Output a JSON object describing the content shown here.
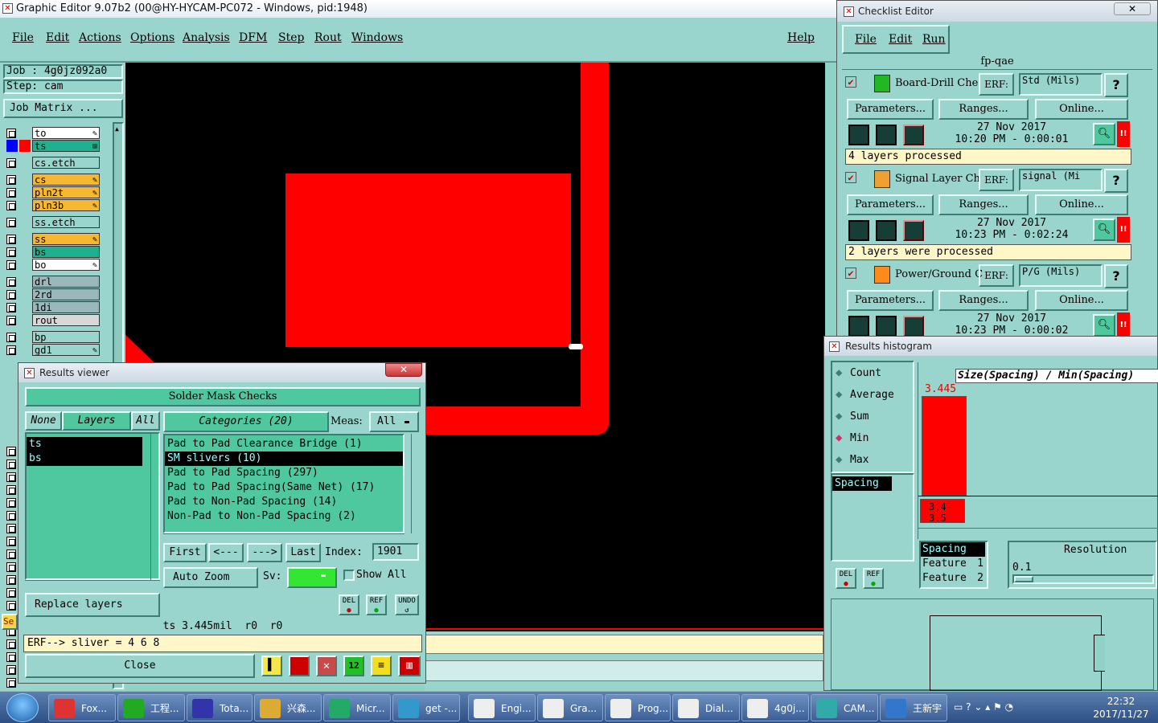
{
  "main_window": {
    "title": "Graphic Editor 9.07b2 (00@HY-HYCAM-PC072 - Windows, pid:1948)",
    "menu": [
      "File",
      "Edit",
      "Actions",
      "Options",
      "Analysis",
      "DFM",
      "Step",
      "Rout",
      "Windows"
    ],
    "help": "Help",
    "job_label": "Job : 4g0jz092a0",
    "step_label": "Step: cam",
    "job_matrix": "Job Matrix ...",
    "layers": [
      {
        "name": "to",
        "color": "#ffffff",
        "mark": "✎"
      },
      {
        "name": "ts",
        "color": "#20b090",
        "mark": "⊞"
      },
      {
        "name": "cs.etch",
        "color": "#99d5cc",
        "mark": ""
      },
      {
        "name": "cs",
        "color": "#f6b830",
        "mark": "✎"
      },
      {
        "name": "pln2t",
        "color": "#f6b830",
        "mark": "✎"
      },
      {
        "name": "pln3b",
        "color": "#f6b830",
        "mark": "✎"
      },
      {
        "name": "ss.etch",
        "color": "#99d5cc",
        "mark": ""
      },
      {
        "name": "ss",
        "color": "#f6b830",
        "mark": "✎"
      },
      {
        "name": "bs",
        "color": "#20b090",
        "mark": ""
      },
      {
        "name": "bo",
        "color": "#ffffff",
        "mark": "✎"
      },
      {
        "name": "drl",
        "color": "#9ab8bc",
        "mark": ""
      },
      {
        "name": "2rd",
        "color": "#9ab8bc",
        "mark": ""
      },
      {
        "name": "1di",
        "color": "#9ab8bc",
        "mark": ""
      },
      {
        "name": "rout",
        "color": "#d8d8d8",
        "mark": ""
      },
      {
        "name": "bp",
        "color": "#99d5cc",
        "mark": ""
      },
      {
        "name": "gd1",
        "color": "#99d5cc",
        "mark": "✎"
      }
    ],
    "se_label": "Se",
    "status_text": "ERF--> sliver = 4 6 8"
  },
  "results_viewer": {
    "title": "Results viewer",
    "header": "Solder Mask Checks",
    "none_btn": "None",
    "layers_btn": "Layers",
    "all_btn": "All",
    "layer_items": [
      "ts",
      "bs"
    ],
    "categories_btn": "Categories (20)",
    "meas_label": "Meas:",
    "meas_value": "All",
    "categories": [
      "Pad to Pad Clearance Bridge (1)",
      "SM slivers (10)",
      "Pad to Pad Spacing (297)",
      "Pad to Pad Spacing(Same Net) (17)",
      "Pad to Non-Pad Spacing (14)",
      "Non-Pad to Non-Pad Spacing (2)"
    ],
    "selected_category": 1,
    "first": "First",
    "prev": "<---",
    "next": "--->",
    "last": "Last",
    "index_label": "Index:",
    "index_value": "1901",
    "auto_zoom": "Auto Zoom",
    "sv_label": "Sv:",
    "show_all": "Show All",
    "replace_layers": "Replace layers",
    "del": "DEL",
    "ref": "REF",
    "undo": "UNDO",
    "result_line": "ts 3.445mil  r0  r0",
    "close": "Close"
  },
  "checklist_editor": {
    "title": "Checklist Editor",
    "menu": [
      "File",
      "Edit",
      "Run"
    ],
    "name": "fp-qae",
    "checks": [
      {
        "name": "Board-Drill Che",
        "erf": "ERF:",
        "param": "Std (Mils)",
        "date": "27 Nov 2017",
        "time": "10:20 PM - 0:00:01",
        "status": "4 layers processed"
      },
      {
        "name": "Signal Layer Ch",
        "erf": "ERF:",
        "param": "signal (Mi",
        "date": "27 Nov 2017",
        "time": "10:23 PM - 0:02:24",
        "status": "2 layers were processed"
      },
      {
        "name": "Power/Ground C",
        "erf": "ERF:",
        "param": "P/G (Mils)",
        "date": "27 Nov 2017",
        "time": "10:23 PM - 0:00:02",
        "status": ""
      }
    ],
    "parameters": "Parameters...",
    "ranges": "Ranges...",
    "online": "Online...",
    "help_q": "?",
    "alert": "!!"
  },
  "histogram": {
    "title": "Results histogram",
    "options": [
      "Count",
      "Average",
      "Sum",
      "Min",
      "Max"
    ],
    "selected_option": "Min",
    "list_item": "Spacing",
    "chart_title": "Size(Spacing) / Min(Spacing)",
    "bar_value_label": "3.445",
    "bin_label": "3.4-3.5",
    "table": [
      [
        "Spacing",
        ""
      ],
      [
        "Feature",
        "1"
      ],
      [
        "Feature",
        "2"
      ]
    ],
    "resolution_label": "Resolution",
    "resolution_value": "0.1",
    "del": "DEL",
    "ref": "REF"
  },
  "taskbar": {
    "items": [
      "Fox...",
      "工程...",
      "Tota...",
      "兴森...",
      "Micr...",
      "get -...",
      "Engi...",
      "Gra...",
      "Prog...",
      "Dial...",
      "4g0j...",
      "CAM...",
      "王新宇"
    ],
    "clock_time": "22:32",
    "clock_date": "2017/11/27"
  },
  "colors": {
    "panel": "#99d5cc",
    "pcb_copper": "#ff0000",
    "canvas": "#000000"
  }
}
